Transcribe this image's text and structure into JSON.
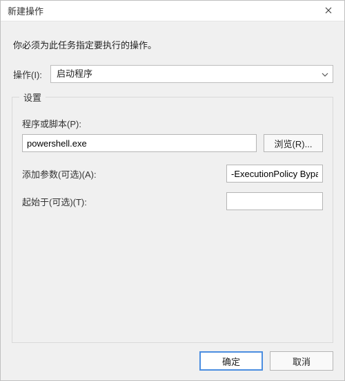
{
  "window": {
    "title": "新建操作"
  },
  "instruction": "你必须为此任务指定要执行的操作。",
  "action": {
    "label": "操作(I):",
    "selected": "启动程序"
  },
  "settings": {
    "legend": "设置",
    "program_label": "程序或脚本(P):",
    "program_value": "powershell.exe",
    "browse_label": "浏览(R)...",
    "args_label": "添加参数(可选)(A):",
    "args_value": "-ExecutionPolicy Bypass",
    "startin_label": "起始于(可选)(T):",
    "startin_value": ""
  },
  "buttons": {
    "ok": "确定",
    "cancel": "取消"
  }
}
